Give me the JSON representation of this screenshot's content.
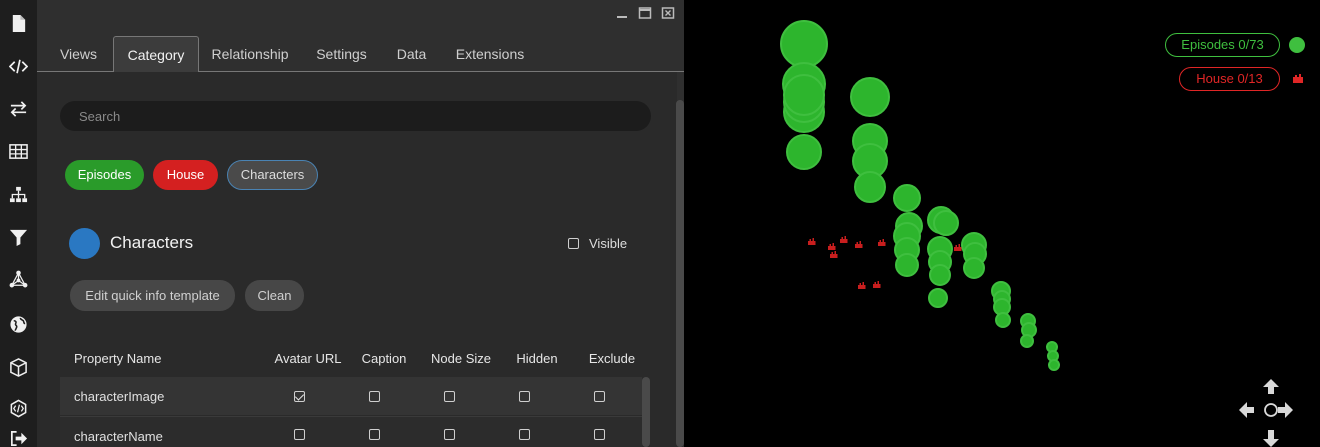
{
  "rail": {
    "items": [
      "file-icon",
      "code-icon",
      "swap-arrows-icon",
      "table-icon",
      "hierarchy-icon",
      "filter-icon",
      "network-icon",
      "globe-icon",
      "cube-icon",
      "graphql-icon",
      "logout-icon"
    ]
  },
  "tabs": [
    "Views",
    "Category",
    "Relationship",
    "Settings",
    "Data",
    "Extensions"
  ],
  "active_tab": "Category",
  "search": {
    "placeholder": "Search",
    "value": ""
  },
  "chips": [
    {
      "label": "Episodes",
      "color": "#2a9b2a"
    },
    {
      "label": "House",
      "color": "#d42020"
    },
    {
      "label": "Characters",
      "color": "#4a4a4a"
    }
  ],
  "category": {
    "name": "Characters",
    "color": "#2a78c2",
    "visible_label": "Visible",
    "visible": false
  },
  "buttons": {
    "edit_template": "Edit quick info template",
    "clean": "Clean"
  },
  "table": {
    "headers": [
      "Property Name",
      "Avatar URL",
      "Caption",
      "Node Size",
      "Hidden",
      "Exclude"
    ],
    "rows": [
      {
        "name": "characterImage",
        "avatar": true,
        "caption": false,
        "node_size": false,
        "hidden": false,
        "exclude": false
      },
      {
        "name": "characterName",
        "avatar": false,
        "caption": false,
        "node_size": false,
        "hidden": false,
        "exclude": false
      }
    ]
  },
  "legend": {
    "episodes": {
      "label": "Episodes 0/73",
      "color": "#3fbf3f"
    },
    "house": {
      "label": "House 0/13",
      "color": "#e02626"
    }
  },
  "colors": {
    "episode_node": "#3fbf3f",
    "house_node": "#c81e1e",
    "panel_bg": "#2f2f2f"
  },
  "nav_controls": [
    "arrow-up-icon",
    "arrow-left-icon",
    "center-icon",
    "arrow-right-icon",
    "arrow-down-icon"
  ]
}
